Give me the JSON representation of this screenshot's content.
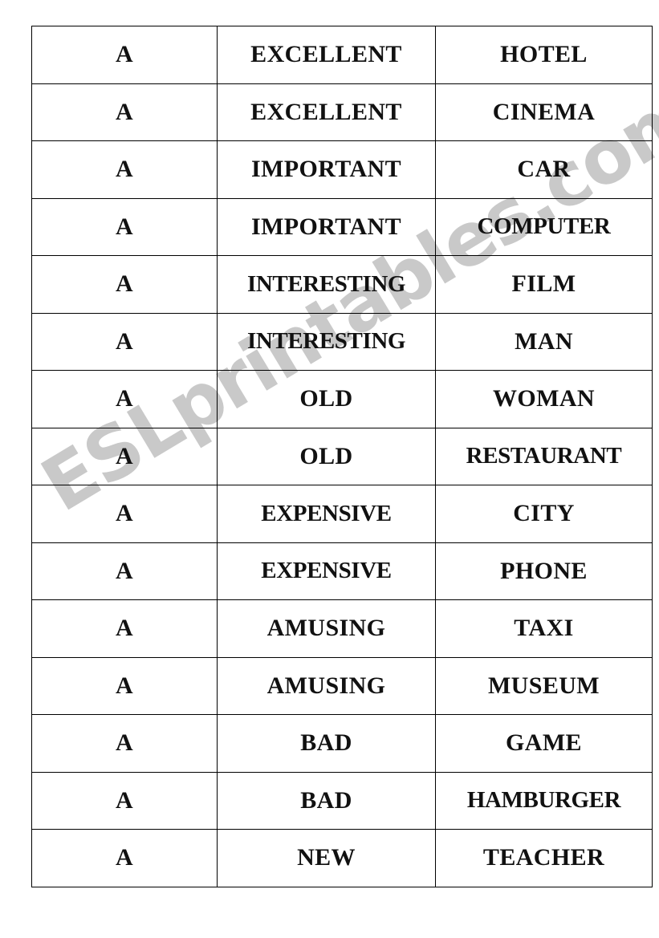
{
  "document": {
    "type": "worksheet-table",
    "columns": [
      "article",
      "adjective",
      "noun"
    ],
    "row_count": 15,
    "border_color": "#000000",
    "text_color": "#111111",
    "background_color": "#ffffff"
  },
  "watermark": {
    "text": "ESLprintables.com",
    "color": "#c9c9c9",
    "rotation_degrees": -31
  },
  "rows": [
    {
      "article": "A",
      "adjective": "EXCELLENT",
      "noun": "HOTEL"
    },
    {
      "article": "A",
      "adjective": "EXCELLENT",
      "noun": "CINEMA"
    },
    {
      "article": "A",
      "adjective": "IMPORTANT",
      "noun": "CAR"
    },
    {
      "article": "A",
      "adjective": "IMPORTANT",
      "noun": "COMPUTER"
    },
    {
      "article": "A",
      "adjective": "INTERESTING",
      "noun": "FILM"
    },
    {
      "article": "A",
      "adjective": "INTERESTING",
      "noun": "MAN"
    },
    {
      "article": "A",
      "adjective": "OLD",
      "noun": "WOMAN"
    },
    {
      "article": "A",
      "adjective": "OLD",
      "noun": "RESTAURANT"
    },
    {
      "article": "A",
      "adjective": "EXPENSIVE",
      "noun": "CITY"
    },
    {
      "article": "A",
      "adjective": "EXPENSIVE",
      "noun": "PHONE"
    },
    {
      "article": "A",
      "adjective": "AMUSING",
      "noun": "TAXI"
    },
    {
      "article": "A",
      "adjective": "AMUSING",
      "noun": "MUSEUM"
    },
    {
      "article": "A",
      "adjective": "BAD",
      "noun": "GAME"
    },
    {
      "article": "A",
      "adjective": "BAD",
      "noun": "HAMBURGER"
    },
    {
      "article": "A",
      "adjective": "NEW",
      "noun": "TEACHER"
    }
  ]
}
